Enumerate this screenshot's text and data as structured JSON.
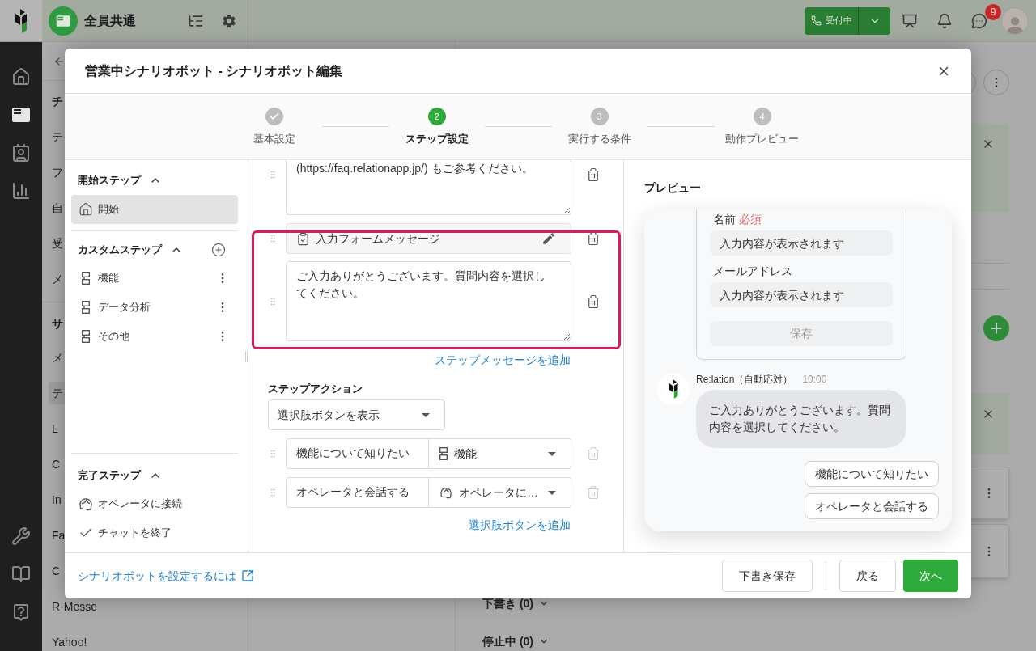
{
  "top_bar": {
    "workspace": "全員共通",
    "status_label": "受付中",
    "chat_badge": "9"
  },
  "nav_rail": {
    "top": [
      {
        "kind": "home",
        "selected": false
      },
      {
        "kind": "chats",
        "selected": true
      },
      {
        "kind": "contacts",
        "selected": false
      },
      {
        "kind": "reports",
        "selected": false
      }
    ],
    "bottom": [
      {
        "kind": "tools",
        "selected": false
      },
      {
        "kind": "manual",
        "selected": false
      },
      {
        "kind": "help",
        "selected": false
      }
    ]
  },
  "channel_list": {
    "groups": [
      {
        "title": "チ",
        "items": [
          {
            "label": "テ",
            "selected": false
          },
          {
            "label": "フ",
            "selected": false
          },
          {
            "label": "自",
            "selected": false
          },
          {
            "label": "受",
            "selected": false
          },
          {
            "label": "メ",
            "selected": false
          }
        ]
      },
      {
        "title": "サ",
        "items": [
          {
            "label": "メ",
            "selected": false
          },
          {
            "label": "テ",
            "selected": true
          },
          {
            "label": "L",
            "selected": false
          },
          {
            "label": "C",
            "selected": false
          },
          {
            "label": "In",
            "selected": false
          },
          {
            "label": "Fa",
            "selected": false
          },
          {
            "label": "C",
            "selected": false
          },
          {
            "label": "R-Messe",
            "selected": false
          },
          {
            "label": "Yahoo!",
            "selected": false
          }
        ]
      }
    ]
  },
  "board": {
    "sections": [
      {
        "label": "下書き (0)",
        "expanded": false
      },
      {
        "label": "停止中 (0)",
        "expanded": false
      }
    ]
  },
  "modal": {
    "title": "営業中シナリオボット - シナリオボット編集",
    "steps": [
      {
        "label": "基本設定",
        "completed": true,
        "selected": false
      },
      {
        "number": "2",
        "label": "ステップ設定",
        "completed": false,
        "selected": true
      },
      {
        "number": "3",
        "label": "実行する条件",
        "completed": false,
        "selected": false
      },
      {
        "number": "4",
        "label": "動作プレビュー",
        "completed": false,
        "selected": false
      }
    ],
    "step_tree": {
      "sections": [
        {
          "title": "開始ステップ",
          "expanded": true,
          "can_add": false,
          "items": [
            {
              "kind": "start",
              "label": "開始",
              "selected": true
            }
          ]
        },
        {
          "title": "カスタムステップ",
          "expanded": true,
          "can_add": true,
          "items": [
            {
              "kind": "custom",
              "label": "機能",
              "selected": false
            },
            {
              "kind": "custom",
              "label": "データ分析",
              "selected": false
            },
            {
              "kind": "custom",
              "label": "その他",
              "selected": false
            }
          ]
        },
        {
          "title": "完了ステップ",
          "expanded": true,
          "can_add": false,
          "items": [
            {
              "kind": "operator",
              "label": "オペレータに接続",
              "selected": false
            },
            {
              "kind": "end",
              "label": "チャットを終了",
              "selected": false
            }
          ]
        }
      ]
    },
    "editor": {
      "messages": [
        {
          "kind": "text",
          "value": "(https://faq.relationapp.jp/) もご参考ください。"
        },
        {
          "kind": "form",
          "label": "入力フォームメッセージ"
        },
        {
          "kind": "text",
          "value": "ご入力ありがとうございます。質問内容を選択してください。"
        }
      ],
      "add_message": "ステップメッセージを追加",
      "action": {
        "title": "ステップアクション",
        "value": "選択肢ボタンを表示"
      },
      "choices": [
        {
          "label": "機能について知りたい",
          "target": {
            "kind": "custom",
            "label": "機能"
          },
          "deletable": false
        },
        {
          "label": "オペレータと会話する",
          "target": {
            "kind": "operator",
            "label": "オペレータに…"
          },
          "deletable": false
        }
      ],
      "add_choice": "選択肢ボタンを追加"
    },
    "preview": {
      "title": "プレビュー",
      "form": {
        "fields": [
          {
            "label": "名前",
            "required_mark": "必須",
            "placeholder": "入力内容が表示されます"
          },
          {
            "label": "メールアドレス",
            "placeholder": "入力内容が表示されます"
          }
        ],
        "submit": "保存",
        "submit_disabled": true
      },
      "message": {
        "sender": "Re:lation（自動応対）",
        "time": "10:00",
        "text": "ご入力ありがとうございます。質問内容を選択してください。"
      },
      "choices": [
        "機能について知りたい",
        "オペレータと会話する"
      ]
    },
    "footer": {
      "help_link": "シナリオボットを設定するには",
      "buttons": [
        {
          "label": "下書き保存",
          "kind": "secondary"
        },
        {
          "label": "戻る",
          "kind": "secondary"
        },
        {
          "label": "次へ",
          "kind": "primary"
        }
      ]
    }
  }
}
